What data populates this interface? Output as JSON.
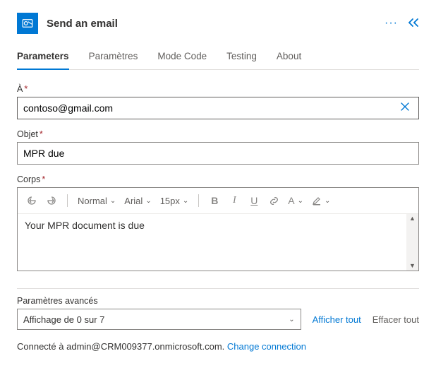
{
  "header": {
    "title": "Send an email",
    "icon": "outlook"
  },
  "tabs": [
    {
      "label": "Parameters",
      "active": true
    },
    {
      "label": "Paramètres",
      "active": false
    },
    {
      "label": "Mode Code",
      "active": false
    },
    {
      "label": "Testing",
      "active": false
    },
    {
      "label": "About",
      "active": false
    }
  ],
  "fields": {
    "to": {
      "label": "À",
      "value": "contoso@gmail.com",
      "required": true
    },
    "subject": {
      "label": "Objet",
      "value": "MPR due",
      "required": true
    },
    "body": {
      "label": "Corps",
      "value": "Your MPR document is due",
      "required": true
    }
  },
  "editor_toolbar": {
    "format_style": "Normal",
    "font_family": "Arial",
    "font_size": "15px"
  },
  "advanced": {
    "section_label": "Paramètres avancés",
    "selector_text": "Affichage de 0 sur 7",
    "show_all": "Afficher tout",
    "clear_all": "Effacer tout"
  },
  "footer": {
    "connected_text": "Connecté à admin@CRM009377.onmicrosoft.com.",
    "change_link": "Change connection"
  }
}
